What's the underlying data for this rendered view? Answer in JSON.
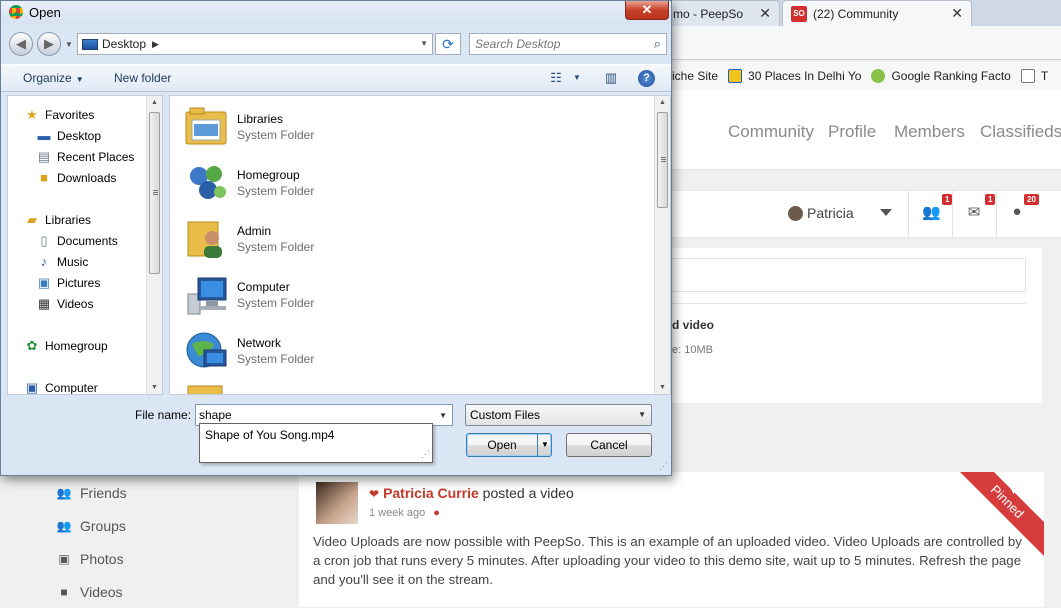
{
  "browser": {
    "tabs": [
      {
        "label": "mo - PeepSo",
        "active": false
      },
      {
        "label": "(22) Community",
        "active": true,
        "favicon": "SO"
      }
    ],
    "bookmarks": [
      {
        "label": "iche Site",
        "icon": "page-icon"
      },
      {
        "label": "30 Places In Delhi Yo",
        "icon": "folder-icon"
      },
      {
        "label": "Google Ranking Facto",
        "icon": "chrome-icon"
      },
      {
        "label": "T",
        "icon": "page-icon"
      }
    ]
  },
  "site": {
    "nav": [
      "Community",
      "Profile",
      "Members",
      "Classifieds"
    ],
    "user": "Patricia",
    "badges": {
      "friends": "1",
      "messages": "1",
      "notifications": "20"
    },
    "upload": {
      "title": "d video",
      "size_hint": "e: 10MB"
    },
    "sidebar": [
      "Friends",
      "Groups",
      "Photos",
      "Videos"
    ],
    "post": {
      "author": "Patricia Currie",
      "action": "posted a video",
      "time": "1 week ago",
      "ribbon": "Pinned",
      "body": "Video Uploads are now possible with PeepSo. This is an example of an uploaded video. Video Uploads are controlled by a cron job that runs every 5 minutes. After uploading your video to this demo site, wait up to 5 minutes. Refresh the page and you'll see it on the stream."
    }
  },
  "dialog": {
    "title": "Open",
    "close_label": "✕",
    "address": "Desktop",
    "search_placeholder": "Search Desktop",
    "organize_label": "Organize",
    "new_folder_label": "New folder",
    "tree": [
      {
        "label": "Favorites",
        "icon": "star-icon",
        "level": 0
      },
      {
        "label": "Desktop",
        "icon": "desktop-icon",
        "level": 1
      },
      {
        "label": "Recent Places",
        "icon": "recent-places-icon",
        "level": 1
      },
      {
        "label": "Downloads",
        "icon": "downloads-icon",
        "level": 1
      },
      {
        "label": "Libraries",
        "icon": "libraries-icon",
        "level": 0
      },
      {
        "label": "Documents",
        "icon": "documents-icon",
        "level": 1
      },
      {
        "label": "Music",
        "icon": "music-icon",
        "level": 1
      },
      {
        "label": "Pictures",
        "icon": "pictures-icon",
        "level": 1
      },
      {
        "label": "Videos",
        "icon": "videos-icon",
        "level": 1
      },
      {
        "label": "Homegroup",
        "icon": "homegroup-icon",
        "level": 0
      },
      {
        "label": "Computer",
        "icon": "computer-icon",
        "level": 0
      }
    ],
    "items": [
      {
        "name": "Libraries",
        "type": "System Folder",
        "icon": "libraries-folder-icon"
      },
      {
        "name": "Homegroup",
        "type": "System Folder",
        "icon": "homegroup-icon"
      },
      {
        "name": "Admin",
        "type": "System Folder",
        "icon": "user-folder-icon"
      },
      {
        "name": "Computer",
        "type": "System Folder",
        "icon": "computer-icon"
      },
      {
        "name": "Network",
        "type": "System Folder",
        "icon": "network-icon"
      }
    ],
    "filename_label": "File name:",
    "filename_value": "shape",
    "autocomplete": [
      "Shape of You Song.mp4"
    ],
    "filter": "Custom Files",
    "open_label": "Open",
    "cancel_label": "Cancel"
  }
}
